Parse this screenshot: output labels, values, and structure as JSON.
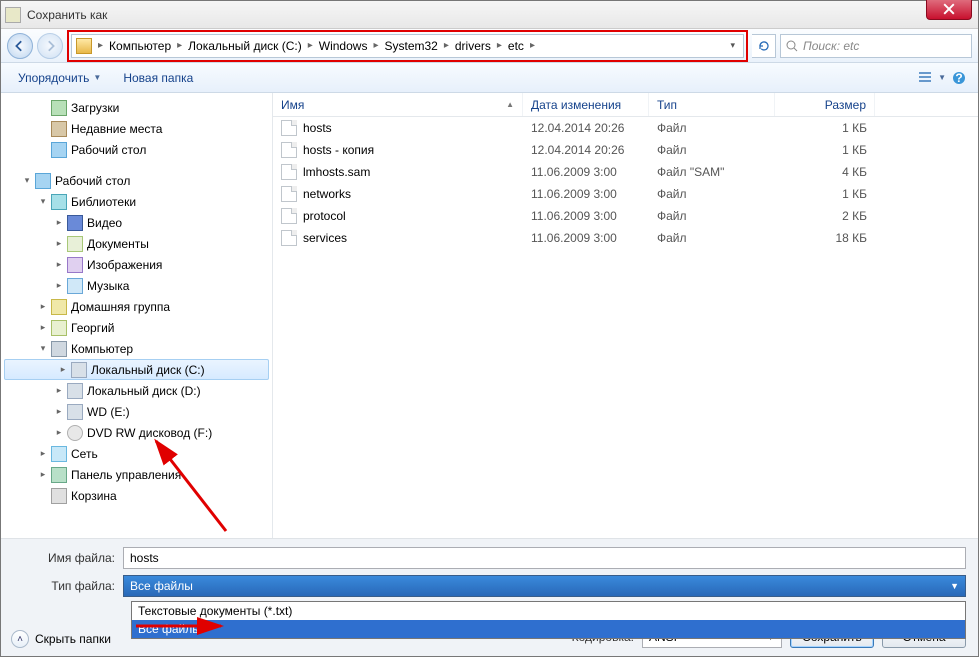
{
  "window": {
    "title": "Сохранить как",
    "close_tooltip": "Закрыть"
  },
  "breadcrumb": {
    "segments": [
      "Компьютер",
      "Локальный диск (C:)",
      "Windows",
      "System32",
      "drivers",
      "etc"
    ]
  },
  "search": {
    "placeholder": "Поиск: etc"
  },
  "toolbar": {
    "organize": "Упорядочить",
    "new_folder": "Новая папка"
  },
  "sidebar": {
    "items": [
      {
        "label": "Загрузки",
        "icon": "ic-downloads",
        "indent": 36
      },
      {
        "label": "Недавние места",
        "icon": "ic-recent",
        "indent": 36
      },
      {
        "label": "Рабочий стол",
        "icon": "ic-desktop",
        "indent": 36
      },
      {
        "gap": true
      },
      {
        "label": "Рабочий стол",
        "icon": "ic-desktop",
        "indent": 20,
        "toggle": "▾"
      },
      {
        "label": "Библиотеки",
        "icon": "ic-lib",
        "indent": 36,
        "toggle": "▾"
      },
      {
        "label": "Видео",
        "icon": "ic-video",
        "indent": 52,
        "toggle": "▸"
      },
      {
        "label": "Документы",
        "icon": "ic-doc",
        "indent": 52,
        "toggle": "▸"
      },
      {
        "label": "Изображения",
        "icon": "ic-img",
        "indent": 52,
        "toggle": "▸"
      },
      {
        "label": "Музыка",
        "icon": "ic-music",
        "indent": 52,
        "toggle": "▸"
      },
      {
        "label": "Домашняя группа",
        "icon": "ic-group",
        "indent": 36,
        "toggle": "▸"
      },
      {
        "label": "Георгий",
        "icon": "ic-user",
        "indent": 36,
        "toggle": "▸"
      },
      {
        "label": "Компьютер",
        "icon": "ic-computer",
        "indent": 36,
        "toggle": "▾"
      },
      {
        "label": "Локальный диск (C:)",
        "icon": "ic-drive",
        "indent": 52,
        "toggle": "▸",
        "selected": true
      },
      {
        "label": "Локальный диск (D:)",
        "icon": "ic-drive",
        "indent": 52,
        "toggle": "▸"
      },
      {
        "label": "WD (E:)",
        "icon": "ic-drive",
        "indent": 52,
        "toggle": "▸"
      },
      {
        "label": "DVD RW дисковод (F:)",
        "icon": "ic-dvd",
        "indent": 52,
        "toggle": "▸"
      },
      {
        "label": "Сеть",
        "icon": "ic-net",
        "indent": 36,
        "toggle": "▸"
      },
      {
        "label": "Панель управления",
        "icon": "ic-panel",
        "indent": 36,
        "toggle": "▸"
      },
      {
        "label": "Корзина",
        "icon": "ic-trash",
        "indent": 36
      }
    ]
  },
  "columns": {
    "name": "Имя",
    "date": "Дата изменения",
    "type": "Тип",
    "size": "Размер"
  },
  "files": [
    {
      "name": "hosts",
      "date": "12.04.2014 20:26",
      "type": "Файл",
      "size": "1 КБ"
    },
    {
      "name": "hosts - копия",
      "date": "12.04.2014 20:26",
      "type": "Файл",
      "size": "1 КБ"
    },
    {
      "name": "lmhosts.sam",
      "date": "11.06.2009 3:00",
      "type": "Файл \"SAM\"",
      "size": "4 КБ"
    },
    {
      "name": "networks",
      "date": "11.06.2009 3:00",
      "type": "Файл",
      "size": "1 КБ"
    },
    {
      "name": "protocol",
      "date": "11.06.2009 3:00",
      "type": "Файл",
      "size": "2 КБ"
    },
    {
      "name": "services",
      "date": "11.06.2009 3:00",
      "type": "Файл",
      "size": "18 КБ"
    }
  ],
  "bottom": {
    "filename_label": "Имя файла:",
    "filename_value": "hosts",
    "filetype_label": "Тип файла:",
    "filetype_value": "Все файлы",
    "filetype_options": [
      "Текстовые документы (*.txt)",
      "Все файлы"
    ],
    "hide_folders": "Скрыть папки",
    "encoding_label": "Кодировка:",
    "encoding_value": "ANSI",
    "save": "Сохранить",
    "cancel": "Отмена"
  }
}
